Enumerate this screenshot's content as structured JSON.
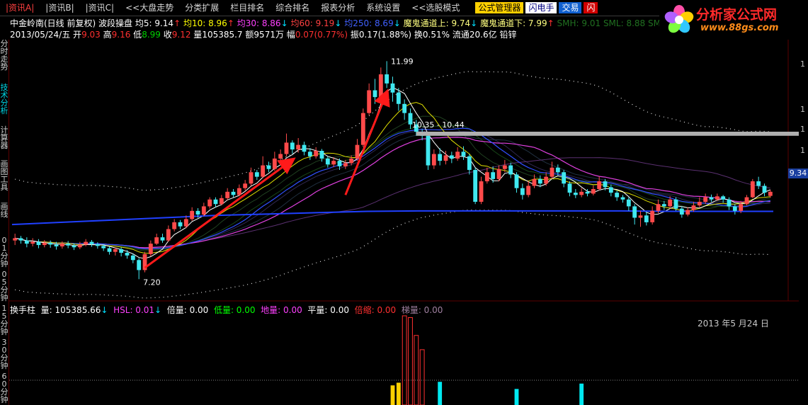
{
  "menu": {
    "items": [
      {
        "label": "|资讯A|",
        "active": true
      },
      {
        "label": "|资讯B|"
      },
      {
        "label": "|资讯C|"
      },
      {
        "label": "<<大盘走势"
      },
      {
        "label": "分类扩展"
      },
      {
        "label": "栏目排名"
      },
      {
        "label": "综合排名"
      },
      {
        "label": "报表分析"
      },
      {
        "label": "系统设置"
      },
      {
        "label": "<<选股模式"
      }
    ],
    "formula_btn": "公式管理器",
    "flash_btn": "闪电手",
    "trade_btn": "交易",
    "red_btn": "闪"
  },
  "logo": {
    "brand": "分析家公式网",
    "url": "www.88gs.com",
    "petal_colors": [
      "#ff4fa8",
      "#ffd000",
      "#30c8ff",
      "#7dff40",
      "#b060ff"
    ]
  },
  "info": {
    "stock": "中金岭南(日线 前复权)",
    "indicator": "波段操盘",
    "ma5": {
      "label": "均5: 9.14",
      "arrow": "↑",
      "color": "#ffffff"
    },
    "ma10": {
      "label": "均10: 8.96",
      "arrow": "↑",
      "color": "#ffff00"
    },
    "ma30": {
      "label": "均30: 8.86",
      "arrow": "↓",
      "color": "#ff40ff"
    },
    "ma60": {
      "label": "均60: 9.19",
      "arrow": "↓",
      "color": "#ff4040"
    },
    "ma250": {
      "label": "均250: 8.69",
      "arrow": "↓",
      "color": "#4060ff"
    },
    "upper": {
      "label": "魔鬼通道上: 9.74",
      "arrow": "↓",
      "color": "#ffff80"
    },
    "lower": {
      "label": "魔鬼通道下: 7.99",
      "arrow": "↑",
      "color": "#ffff80"
    },
    "smh": {
      "label": "SMH: 9.01",
      "color": "#207020"
    },
    "sml": {
      "label": "SML: 8.88",
      "color": "#207020"
    },
    "smj": {
      "label": "SMJ: 8.",
      "color": "#207020"
    },
    "date": "2013/05/24/五",
    "open_label": "开",
    "open": "9.03",
    "high_label": "高",
    "high": "9.16",
    "low_label": "低",
    "low": "8.99",
    "close_label": "收",
    "close": "9.12",
    "vol_label": "量",
    "vol": "105385.7",
    "amount_label": "额",
    "amount": "9571万",
    "chg_label": "幅",
    "chg": "0.07(0.77%)",
    "amp_label": "振",
    "amp": "0.17(1.88%)",
    "turn_label": "换",
    "turn": "0.51%",
    "float_label": "流通",
    "float": "20.6亿",
    "sector": "铅锌"
  },
  "sidebar": {
    "main_tabs": [
      "分时走势",
      "技术分析",
      "计算器",
      "画图工具",
      "画线"
    ],
    "lower_tabs": [
      "01分钟",
      "05分钟",
      "15分钟",
      "30分钟",
      "60分钟"
    ]
  },
  "chart_labels": {
    "high": "11.99",
    "low": "7.20",
    "range": "10.35 - 10.44",
    "last_price": "9.34",
    "right_ticks": [
      "1",
      "1",
      "1",
      "1"
    ]
  },
  "volume": {
    "title": "换手柱",
    "vol": {
      "label": "量: 105385.66",
      "arrow": "↓"
    },
    "hsl": {
      "label": "HSL: 0.01",
      "arrow": "↓"
    },
    "bei": "倍量: 0.00",
    "di": "低量: 0.00",
    "diliang": "地量: 0.00",
    "ping": "平量: 0.00",
    "beisuo": "倍缩: 0.00",
    "ti": "梯量: 0.00",
    "date": "2013 年5 月24 日"
  },
  "chart_data": {
    "type": "candlestick",
    "y_range": [
      6.8,
      12.4
    ],
    "candles": [
      [
        8.05,
        8.1,
        8.2,
        7.95
      ],
      [
        8.1,
        8.05,
        8.15,
        7.98
      ],
      [
        8.05,
        7.98,
        8.12,
        7.9
      ],
      [
        7.98,
        8.02,
        8.1,
        7.92
      ],
      [
        8.02,
        7.95,
        8.08,
        7.88
      ],
      [
        7.95,
        8.0,
        8.06,
        7.9
      ],
      [
        8.0,
        7.96,
        8.05,
        7.89
      ],
      [
        7.96,
        7.92,
        8.02,
        7.85
      ],
      [
        7.92,
        7.98,
        8.03,
        7.87
      ],
      [
        7.98,
        7.94,
        8.04,
        7.88
      ],
      [
        7.94,
        7.9,
        7.99,
        7.84
      ],
      [
        7.9,
        7.96,
        8.02,
        7.86
      ],
      [
        7.96,
        8.02,
        8.08,
        7.92
      ],
      [
        8.02,
        7.97,
        8.06,
        7.91
      ],
      [
        7.97,
        7.93,
        8.01,
        7.87
      ],
      [
        7.93,
        7.88,
        7.97,
        7.82
      ],
      [
        7.88,
        7.8,
        7.92,
        7.74
      ],
      [
        7.8,
        7.86,
        7.9,
        7.72
      ],
      [
        7.86,
        7.78,
        7.9,
        7.7
      ],
      [
        7.78,
        7.72,
        7.84,
        7.65
      ],
      [
        7.72,
        7.62,
        7.76,
        7.55
      ],
      [
        7.62,
        7.4,
        7.66,
        7.2
      ],
      [
        7.4,
        7.75,
        7.8,
        7.35
      ],
      [
        7.75,
        7.98,
        8.05,
        7.7
      ],
      [
        7.98,
        8.12,
        8.2,
        7.95
      ],
      [
        8.12,
        8.05,
        8.2,
        8.0
      ],
      [
        8.05,
        8.3,
        8.38,
        8.02
      ],
      [
        8.3,
        8.45,
        8.52,
        8.25
      ],
      [
        8.45,
        8.36,
        8.5,
        8.3
      ],
      [
        8.36,
        8.52,
        8.6,
        8.32
      ],
      [
        8.52,
        8.7,
        8.78,
        8.48
      ],
      [
        8.7,
        8.62,
        8.76,
        8.55
      ],
      [
        8.62,
        8.8,
        8.88,
        8.58
      ],
      [
        8.8,
        8.95,
        9.0,
        8.75
      ],
      [
        8.95,
        8.85,
        9.0,
        8.78
      ],
      [
        8.85,
        8.98,
        9.05,
        8.82
      ],
      [
        8.98,
        9.12,
        9.2,
        8.94
      ],
      [
        9.12,
        9.05,
        9.18,
        9.0
      ],
      [
        9.05,
        9.2,
        9.28,
        9.02
      ],
      [
        9.2,
        9.3,
        9.38,
        9.15
      ],
      [
        9.3,
        9.55,
        9.65,
        9.25
      ],
      [
        9.55,
        9.45,
        9.6,
        9.38
      ],
      [
        9.45,
        9.7,
        9.9,
        9.42
      ],
      [
        9.7,
        9.62,
        9.78,
        9.55
      ],
      [
        9.62,
        9.85,
        10.0,
        9.58
      ],
      [
        9.85,
        9.95,
        10.05,
        9.8
      ],
      [
        9.95,
        10.2,
        10.4,
        9.9
      ],
      [
        10.2,
        10.05,
        10.25,
        9.95
      ],
      [
        10.05,
        10.15,
        10.3,
        9.98
      ],
      [
        10.15,
        10.0,
        10.22,
        9.92
      ],
      [
        10.0,
        9.9,
        10.08,
        9.82
      ],
      [
        9.9,
        10.02,
        10.1,
        9.85
      ],
      [
        10.02,
        9.85,
        10.06,
        9.78
      ],
      [
        9.85,
        9.72,
        9.9,
        9.65
      ],
      [
        9.72,
        9.8,
        9.88,
        9.66
      ],
      [
        9.8,
        9.68,
        9.85,
        9.6
      ],
      [
        9.68,
        9.75,
        9.82,
        9.62
      ],
      [
        9.75,
        9.85,
        9.92,
        9.7
      ],
      [
        9.85,
        10.15,
        10.28,
        9.8
      ],
      [
        10.15,
        10.85,
        10.95,
        10.1
      ],
      [
        10.85,
        11.35,
        11.5,
        10.8
      ],
      [
        11.35,
        11.2,
        11.6,
        11.05
      ],
      [
        11.2,
        11.7,
        11.85,
        11.15
      ],
      [
        11.7,
        11.5,
        11.99,
        11.4
      ],
      [
        11.5,
        11.3,
        11.65,
        11.1
      ],
      [
        11.3,
        11.05,
        11.4,
        10.9
      ],
      [
        11.05,
        10.85,
        11.15,
        10.7
      ],
      [
        10.85,
        10.6,
        10.95,
        10.5
      ],
      [
        10.6,
        10.44,
        10.7,
        10.35
      ],
      [
        10.44,
        10.35,
        10.5,
        10.25
      ],
      [
        10.35,
        9.7,
        10.4,
        9.6
      ],
      [
        9.7,
        9.95,
        10.05,
        9.62
      ],
      [
        9.95,
        9.8,
        10.08,
        9.7
      ],
      [
        9.8,
        9.92,
        10.02,
        9.72
      ],
      [
        9.92,
        9.85,
        10.0,
        9.75
      ],
      [
        9.85,
        10.0,
        10.1,
        9.8
      ],
      [
        10.0,
        9.9,
        10.12,
        9.82
      ],
      [
        9.9,
        9.6,
        9.95,
        9.5
      ],
      [
        9.6,
        8.9,
        9.65,
        8.85
      ],
      [
        8.9,
        9.35,
        9.45,
        8.85
      ],
      [
        9.35,
        9.55,
        9.65,
        9.3
      ],
      [
        9.55,
        9.4,
        9.68,
        9.32
      ],
      [
        9.4,
        9.62,
        9.7,
        9.35
      ],
      [
        9.62,
        9.7,
        9.82,
        9.55
      ],
      [
        9.7,
        9.5,
        9.76,
        9.42
      ],
      [
        9.5,
        9.2,
        9.55,
        9.1
      ],
      [
        9.2,
        9.05,
        9.3,
        8.95
      ],
      [
        9.05,
        9.25,
        9.35,
        9.0
      ],
      [
        9.25,
        9.4,
        9.5,
        9.2
      ],
      [
        9.4,
        9.3,
        9.48,
        9.22
      ],
      [
        9.3,
        9.45,
        9.55,
        9.25
      ],
      [
        9.45,
        9.65,
        9.78,
        9.4
      ],
      [
        9.65,
        9.55,
        9.72,
        9.48
      ],
      [
        9.55,
        9.3,
        9.6,
        9.22
      ],
      [
        9.3,
        9.1,
        9.35,
        9.02
      ],
      [
        9.1,
        9.05,
        9.18,
        8.98
      ],
      [
        9.05,
        9.12,
        9.2,
        9.0
      ],
      [
        9.12,
        9.08,
        9.18,
        9.02
      ],
      [
        9.08,
        9.18,
        9.26,
        9.04
      ],
      [
        9.18,
        9.35,
        9.45,
        9.15
      ],
      [
        9.35,
        9.22,
        9.4,
        9.15
      ],
      [
        9.22,
        9.1,
        9.28,
        9.02
      ],
      [
        9.1,
        9.0,
        9.15,
        8.92
      ],
      [
        9.0,
        8.95,
        9.05,
        8.88
      ],
      [
        8.95,
        8.8,
        9.0,
        8.7
      ],
      [
        8.8,
        8.55,
        8.85,
        8.4
      ],
      [
        8.55,
        8.6,
        8.7,
        8.35
      ],
      [
        8.6,
        8.45,
        8.68,
        8.38
      ],
      [
        8.45,
        8.7,
        8.8,
        8.4
      ],
      [
        8.7,
        8.85,
        8.95,
        8.65
      ],
      [
        8.85,
        8.8,
        8.92,
        8.72
      ],
      [
        8.8,
        8.95,
        9.02,
        8.75
      ],
      [
        8.95,
        8.75,
        9.0,
        8.7
      ],
      [
        8.75,
        8.62,
        8.8,
        8.55
      ],
      [
        8.62,
        8.72,
        8.78,
        8.58
      ],
      [
        8.72,
        8.82,
        8.9,
        8.68
      ],
      [
        8.82,
        8.9,
        9.0,
        8.78
      ],
      [
        8.9,
        9.0,
        9.08,
        8.85
      ],
      [
        9.0,
        8.95,
        9.06,
        8.9
      ],
      [
        8.95,
        9.02,
        9.08,
        8.92
      ],
      [
        9.02,
        8.95,
        9.05,
        8.88
      ],
      [
        8.95,
        8.8,
        9.0,
        8.72
      ],
      [
        8.8,
        8.7,
        8.85,
        8.62
      ],
      [
        8.7,
        8.85,
        8.92,
        8.65
      ],
      [
        8.85,
        9.0,
        9.05,
        8.82
      ],
      [
        9.0,
        9.35,
        9.4,
        8.98
      ],
      [
        9.35,
        9.25,
        9.45,
        9.18
      ],
      [
        9.25,
        9.1,
        9.3,
        9.02
      ],
      [
        9.03,
        9.12,
        9.16,
        8.99
      ]
    ],
    "ma250": [
      8.4,
      8.45,
      8.5,
      8.55,
      8.6,
      8.63,
      8.66,
      8.69,
      8.7,
      8.7,
      8.7,
      8.7,
      8.7,
      8.69,
      8.69,
      8.69
    ],
    "volume_bars": [
      {
        "i": 66,
        "v": 1.0,
        "c": "#ff3030",
        "hollow": true
      },
      {
        "i": 67,
        "v": 0.98,
        "c": "#ff3030",
        "hollow": true
      },
      {
        "i": 68,
        "v": 0.78,
        "c": "#ff3030",
        "hollow": true
      },
      {
        "i": 69,
        "v": 0.62,
        "c": "#ff3030",
        "hollow": true
      },
      {
        "i": 65,
        "v": 0.25,
        "c": "#ffd000",
        "hollow": false
      },
      {
        "i": 64,
        "v": 0.22,
        "c": "#ffd000",
        "hollow": false
      },
      {
        "i": 72,
        "v": 0.26,
        "c": "#00e8f0",
        "hollow": false
      },
      {
        "i": 85,
        "v": 0.18,
        "c": "#00e8f0",
        "hollow": false
      },
      {
        "i": 96,
        "v": 0.24,
        "c": "#00e8f0",
        "hollow": false
      }
    ]
  }
}
